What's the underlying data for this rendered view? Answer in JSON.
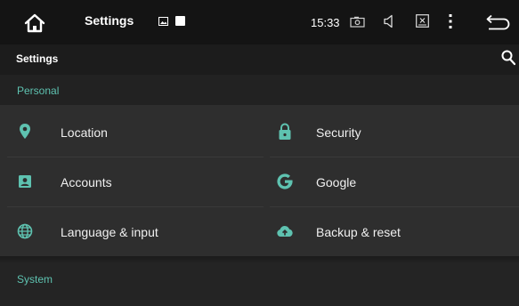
{
  "status_bar": {
    "title": "Settings",
    "time": "15:33",
    "icons": [
      "home-icon",
      "gallery-icon",
      "square-icon",
      "camera-icon",
      "volume-icon",
      "close-box-icon",
      "more-vert-icon",
      "back-icon"
    ]
  },
  "action_bar": {
    "title": "Settings",
    "search_icon": "search-icon"
  },
  "sections": [
    {
      "header": "Personal",
      "items": [
        {
          "label": "Location",
          "icon": "location-pin-icon"
        },
        {
          "label": "Security",
          "icon": "lock-icon"
        },
        {
          "label": "Accounts",
          "icon": "account-box-icon"
        },
        {
          "label": "Google",
          "icon": "google-icon"
        },
        {
          "label": "Language & input",
          "icon": "globe-icon"
        },
        {
          "label": "Backup & reset",
          "icon": "cloud-upload-icon"
        }
      ]
    },
    {
      "header": "System",
      "items": []
    }
  ],
  "colors": {
    "accent": "#5ec2b0",
    "background": "#222222",
    "tile_background": "#2e2e2e",
    "status_bar": "#141414"
  }
}
